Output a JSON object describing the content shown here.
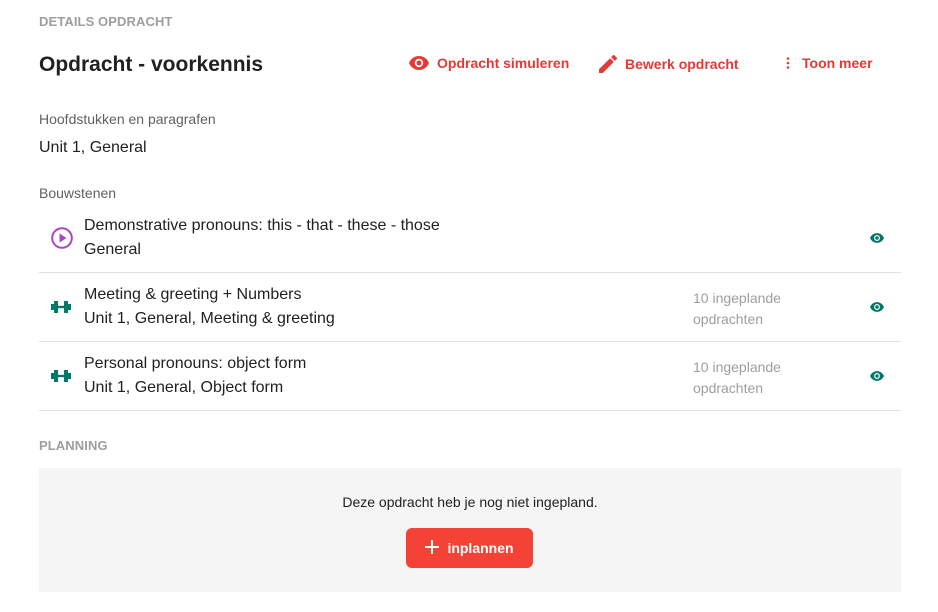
{
  "details": {
    "section_title": "DETAILS OPDRACHT",
    "title": "Opdracht - voorkennis",
    "actions": {
      "simulate": {
        "label": "Opdracht simuleren",
        "icon": "eye-icon"
      },
      "edit": {
        "label": "Bewerk opdracht",
        "icon": "pencil-icon"
      },
      "more": {
        "label": "Toon meer",
        "icon": "more-vertical-icon"
      }
    },
    "chapters_label": "Hoofdstukken en paragrafen",
    "chapters_value": "Unit 1, General",
    "blocks_label": "Bouwstenen",
    "blocks": [
      {
        "title": "Demonstrative pronouns: this - that - these - those",
        "subtitle": "General",
        "meta_line1": "",
        "meta_line2": "",
        "icon": "play-circle-icon"
      },
      {
        "title": "Meeting & greeting + Numbers",
        "subtitle": "Unit 1, General, Meeting & greeting",
        "meta_line1": "10 ingeplande",
        "meta_line2": "opdrachten",
        "icon": "dumbbell-icon"
      },
      {
        "title": "Personal pronouns: object form",
        "subtitle": "Unit 1, General, Object form",
        "meta_line1": "10 ingeplande",
        "meta_line2": "opdrachten",
        "icon": "dumbbell-icon"
      }
    ]
  },
  "planning": {
    "section_title": "PLANNING",
    "empty_text": "Deze opdracht heb je nog niet ingepland.",
    "button_label": "inplannen"
  },
  "colors": {
    "accent": "#e53935",
    "button": "#f44336",
    "teal": "#00796b",
    "purple": "#ab47bc",
    "muted": "#9e9e9e"
  }
}
